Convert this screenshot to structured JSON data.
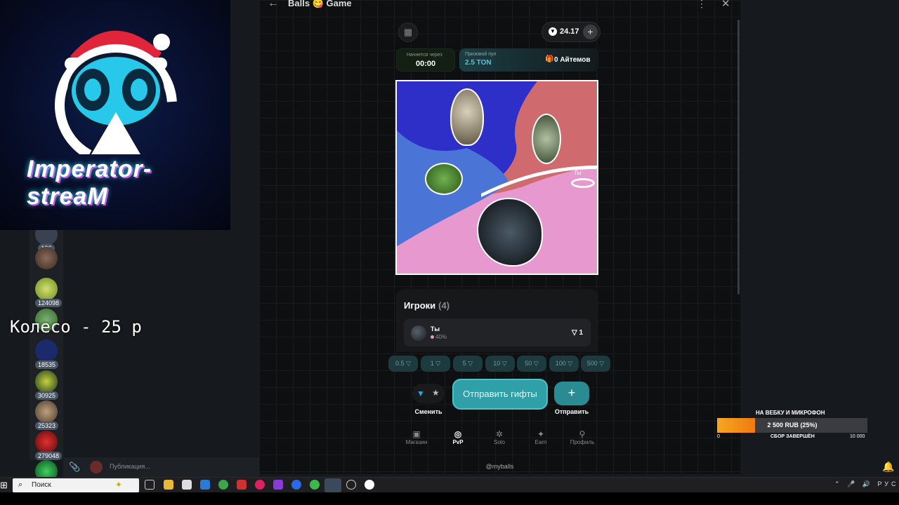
{
  "app": {
    "title": "Balls 😋 Game"
  },
  "overlay": {
    "logo_text": "Imperator-streaM",
    "wheel_text": "Колесо - 25 р"
  },
  "sidebar": {
    "counts": [
      "196",
      "124098",
      "18535",
      "30925",
      "25323",
      "279048"
    ]
  },
  "header": {
    "balance": "24.17"
  },
  "info": {
    "start_label": "Начнется через",
    "start_value": "00:00",
    "pool_label": "Призовой пул",
    "pool_value": "2.5 TON",
    "items_value": "0 Айтемов"
  },
  "arena": {
    "you_tag": "Ты"
  },
  "players": {
    "title": "Игроки",
    "count": "(4)",
    "rows": [
      {
        "name": "Ты",
        "share": "40%",
        "bet": "1"
      }
    ]
  },
  "bets": [
    "0.5",
    "1",
    "5",
    "10",
    "50",
    "100",
    "500"
  ],
  "actions": {
    "swap": "Сменить",
    "send": "Отправить гифты",
    "add": "Отправить"
  },
  "nav": [
    {
      "label": "Магазин",
      "icon": "shop-icon"
    },
    {
      "label": "PvP",
      "icon": "pvp-icon"
    },
    {
      "label": "Solo",
      "icon": "solo-icon"
    },
    {
      "label": "Earn",
      "icon": "earn-icon"
    },
    {
      "label": "Профиль",
      "icon": "profile-icon"
    }
  ],
  "nav_active": "PvP",
  "handle": "@myballs",
  "telegram": {
    "publication": "Публикация..."
  },
  "donation": {
    "title": "НА ВЕБКУ И МИКРОФОН",
    "amount": "2 500 RUB (25%)",
    "progress": 0.25,
    "min": "0",
    "status": "СБОР ЗАВЕРШЁН",
    "max": "10 000"
  },
  "taskbar": {
    "search_placeholder": "Поиск",
    "lang": "РУС"
  },
  "colors": {
    "accent": "#2fa0a8",
    "pool_text": "#55c6d8",
    "arena_pink": "#e798cf",
    "arena_blue": "#2e2fc8",
    "arena_red": "#cf6b6e",
    "arena_lightblue": "#4a74d6",
    "donation": "#f07a10"
  }
}
